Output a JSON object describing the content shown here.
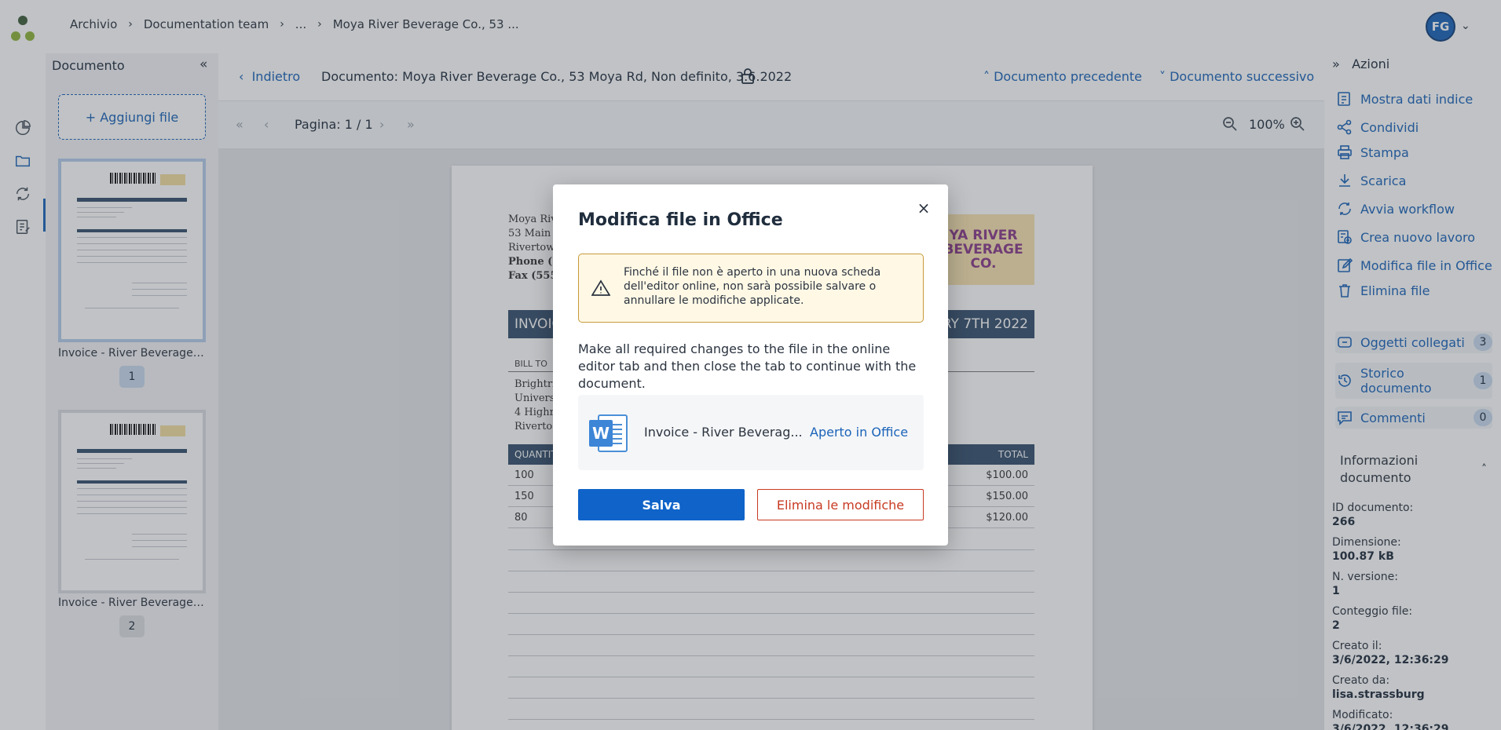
{
  "breadcrumb": [
    "Archivio",
    "Documentation team",
    "...",
    "Moya River Beverage Co., 53 ..."
  ],
  "user": {
    "initials": "FG"
  },
  "left_panel": {
    "title": "Documento",
    "add_file": "+ Aggiungi file",
    "thumbnails": [
      {
        "label": "Invoice - River Beverage t...",
        "page": "1"
      },
      {
        "label": "Invoice - River Beverage t...",
        "page": "2"
      }
    ]
  },
  "doc_header": {
    "back": "Indietro",
    "title": "Documento: Moya River Beverage Co., 53 Moya Rd, Non definito, 3.6.2022",
    "prev": "Documento precedente",
    "next": "Documento successivo"
  },
  "page_toolbar": {
    "page_label": "Pagina: 1 / 1",
    "zoom": "100%"
  },
  "document": {
    "from_lines": [
      "Moya Rive",
      "53 Main S",
      "Rivertowr",
      "Phone (5",
      "Fax (555)"
    ],
    "logo_text": "YA RIVER\nBEVERAGE CO.",
    "band_left": "INVOIC",
    "band_right": "UARY 7TH 2022",
    "bill_to": "BILL TO",
    "bill_lines": [
      "Brightric",
      "Universi",
      "4 Highric",
      "Riverto"
    ],
    "table_head_left": "QUANTIT",
    "table_head_right": "TOTAL",
    "rows": [
      {
        "qty": "100",
        "total": "$100.00"
      },
      {
        "qty": "150",
        "total": "$150.00"
      },
      {
        "qty": "80",
        "total": "$120.00"
      }
    ]
  },
  "actions": {
    "title": "Azioni",
    "items": [
      "Mostra dati indice",
      "Condividi",
      "Stampa",
      "Scarica",
      "Avvia workflow",
      "Crea nuovo lavoro",
      "Modifica file in Office",
      "Elimina file"
    ],
    "related": [
      {
        "label": "Oggetti collegati",
        "count": "3"
      },
      {
        "label": "Storico documento",
        "count": "1"
      },
      {
        "label": "Commenti",
        "count": "0"
      }
    ],
    "info_title": "Informazioni documento",
    "info": [
      {
        "label": "ID documento:",
        "value": "266"
      },
      {
        "label": "Dimensione:",
        "value": "100.87 kB"
      },
      {
        "label": "N. versione:",
        "value": "1"
      },
      {
        "label": "Conteggio file:",
        "value": "2"
      },
      {
        "label": "Creato il:",
        "value": "3/6/2022, 12:36:29"
      },
      {
        "label": "Creato da:",
        "value": "lisa.strassburg"
      },
      {
        "label": "Modificato:",
        "value": "3/6/2022, 12:36:29"
      }
    ]
  },
  "modal": {
    "title": "Modifica file in Office",
    "warning": "Finché il file non è aperto in una nuova scheda dell'editor online, non sarà possibile salvare o annullare le modifiche applicate.",
    "body": "Make all required changes to the file in the online editor tab and then close the tab to continue with the document.",
    "file_name": "Invoice - River Beverag...",
    "file_status": "Aperto in Office",
    "save": "Salva",
    "discard": "Elimina le modifiche"
  },
  "colors": {
    "accent": "#1a63b8",
    "primary_button": "#0f63c9",
    "danger": "#c83a22",
    "warning_bg": "#fff8e5"
  }
}
